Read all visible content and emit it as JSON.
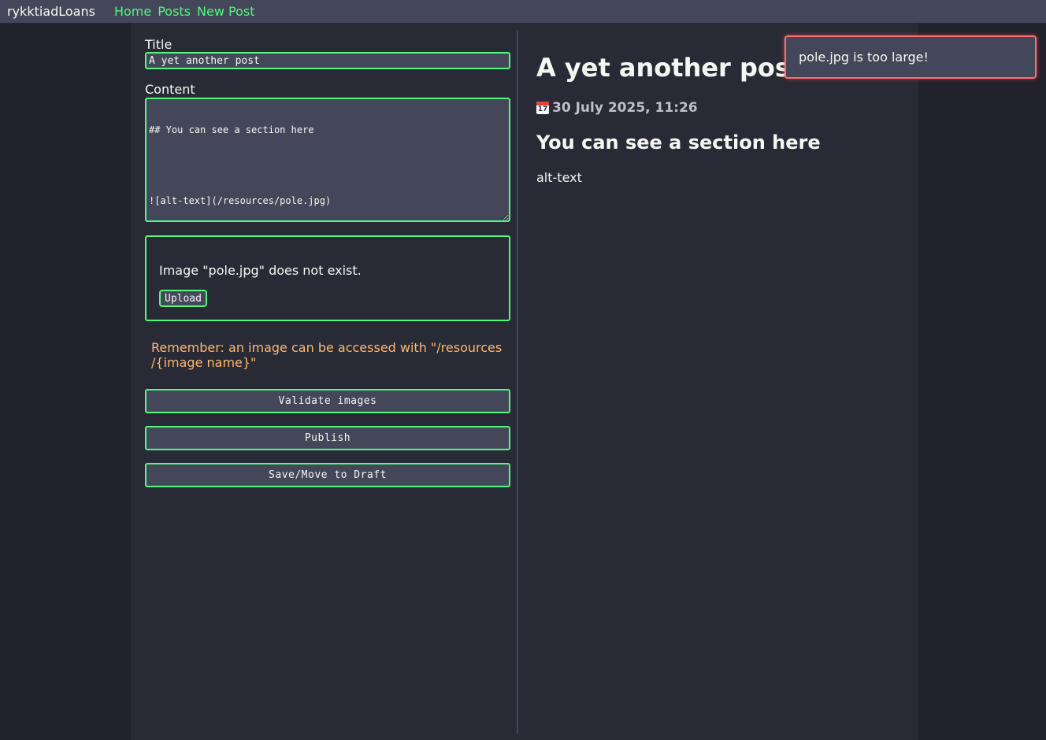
{
  "navbar": {
    "brand": "rykktiadLoans",
    "links": [
      "Home",
      "Posts",
      "New Post"
    ]
  },
  "editor": {
    "title_label": "Title",
    "title_value": "A yet another post",
    "content_label": "Content",
    "content_lines": [
      "## You can see a section here",
      "",
      "![alt-text](/resources/pole.jpg)"
    ],
    "upload_message": "Image \"pole.jpg\" does not exist.",
    "upload_button": "Upload",
    "reminder": "Remember: an image can be accessed with \"/resources /{image name}\"",
    "validate_button": "Validate images",
    "publish_button": "Publish",
    "draft_button": "Save/Move to Draft"
  },
  "preview": {
    "title": "A yet another post",
    "date": "30 July 2025, 11:26",
    "section_heading": "You can see a section here",
    "image_alt": "alt-text"
  },
  "toast": {
    "message": "pole.jpg is too large!"
  },
  "colors": {
    "background": "#21222c",
    "panel": "#282a36",
    "accent": "#50fa7b",
    "warning": "#ffb86c",
    "error": "#ff5555"
  },
  "icons": {
    "date": "calendar-icon"
  }
}
